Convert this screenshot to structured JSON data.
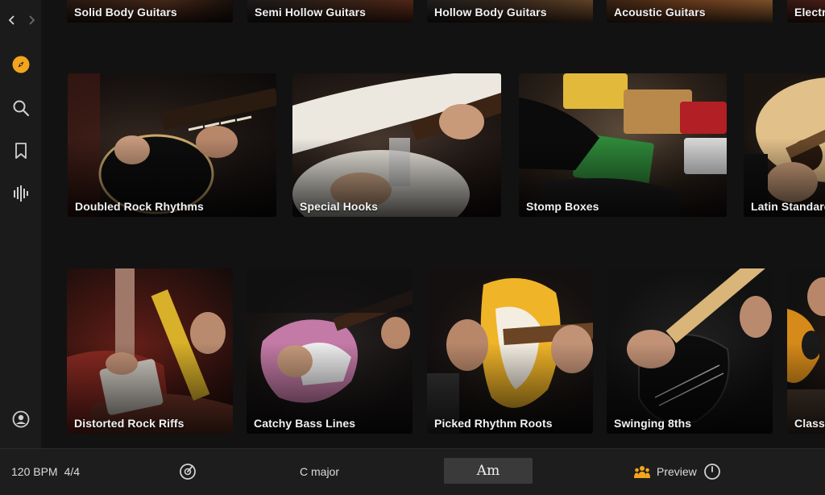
{
  "sidebar": {
    "icons": [
      "back-chevron-icon",
      "forward-chevron-icon",
      "compass-icon",
      "search-icon",
      "bookmark-icon",
      "waveform-icon",
      "account-icon"
    ]
  },
  "top_row": [
    {
      "label": "Solid Body Guitars"
    },
    {
      "label": "Semi Hollow Guitars"
    },
    {
      "label": "Hollow Body Guitars"
    },
    {
      "label": "Acoustic Guitars"
    },
    {
      "label": "Electr"
    }
  ],
  "row_2": [
    {
      "label": "Doubled Rock Rhythms"
    },
    {
      "label": "Special Hooks"
    },
    {
      "label": "Stomp Boxes"
    },
    {
      "label": "Latin Standard"
    }
  ],
  "row_3": [
    {
      "label": "Distorted Rock Riffs"
    },
    {
      "label": "Catchy Bass Lines"
    },
    {
      "label": "Picked Rhythm Roots"
    },
    {
      "label": "Swinging 8ths"
    },
    {
      "label": "Classi"
    }
  ],
  "bottom_bar": {
    "tempo": "120 BPM",
    "time_signature": "4/4",
    "scale": "C major",
    "chord": "Am",
    "preview_label": "Preview"
  },
  "colors": {
    "accent": "#f2a51d",
    "background": "#121212",
    "bottom_bar": "#1d1d1d"
  }
}
